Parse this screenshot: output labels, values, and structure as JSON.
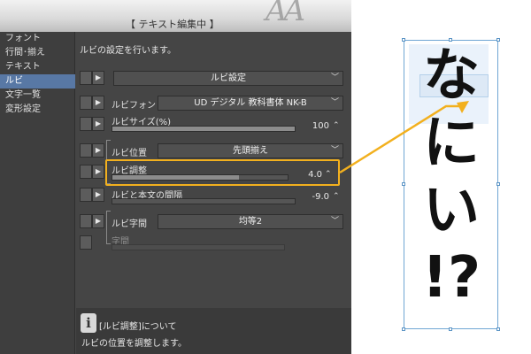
{
  "banner": {
    "title": "【 テキスト編集中 】"
  },
  "sidebar": {
    "items": [
      {
        "label": "フォント"
      },
      {
        "label": "行間･揃え"
      },
      {
        "label": "テキスト"
      },
      {
        "label": "ルビ"
      },
      {
        "label": "文字一覧"
      },
      {
        "label": "変形設定"
      }
    ]
  },
  "main": {
    "description": "ルビの設定を行います。",
    "ruby_setting": {
      "value": "ルビ設定"
    },
    "ruby_font": {
      "label": "ルビフォント",
      "value": "UD デジタル 教科書体 NK-B"
    },
    "ruby_size": {
      "label": "ルビサイズ(%)",
      "value": "100",
      "fraction": 1.0
    },
    "ruby_position": {
      "label": "ルビ位置",
      "value": "先頭揃え"
    },
    "ruby_adjust": {
      "label": "ルビ調整",
      "value": "4.0",
      "fraction": 0.72
    },
    "ruby_body_gap": {
      "label": "ルビと本文の間隔",
      "value": "-9.0"
    },
    "ruby_spacing": {
      "label": "ルビ字間",
      "value": "均等2"
    },
    "char_spacing": {
      "label": "字間"
    }
  },
  "info": {
    "icon": "info-icon",
    "title": "[ルビ調整]について",
    "body": "ルビの位置を調整します。"
  },
  "canvas": {
    "vertical_text": [
      "な",
      "に",
      "い",
      "!?"
    ]
  },
  "colors": {
    "panel_bg": "#454545",
    "active_nav": "#5878a5",
    "highlight": "#f2b01e",
    "selection": "#6fa6d4"
  }
}
